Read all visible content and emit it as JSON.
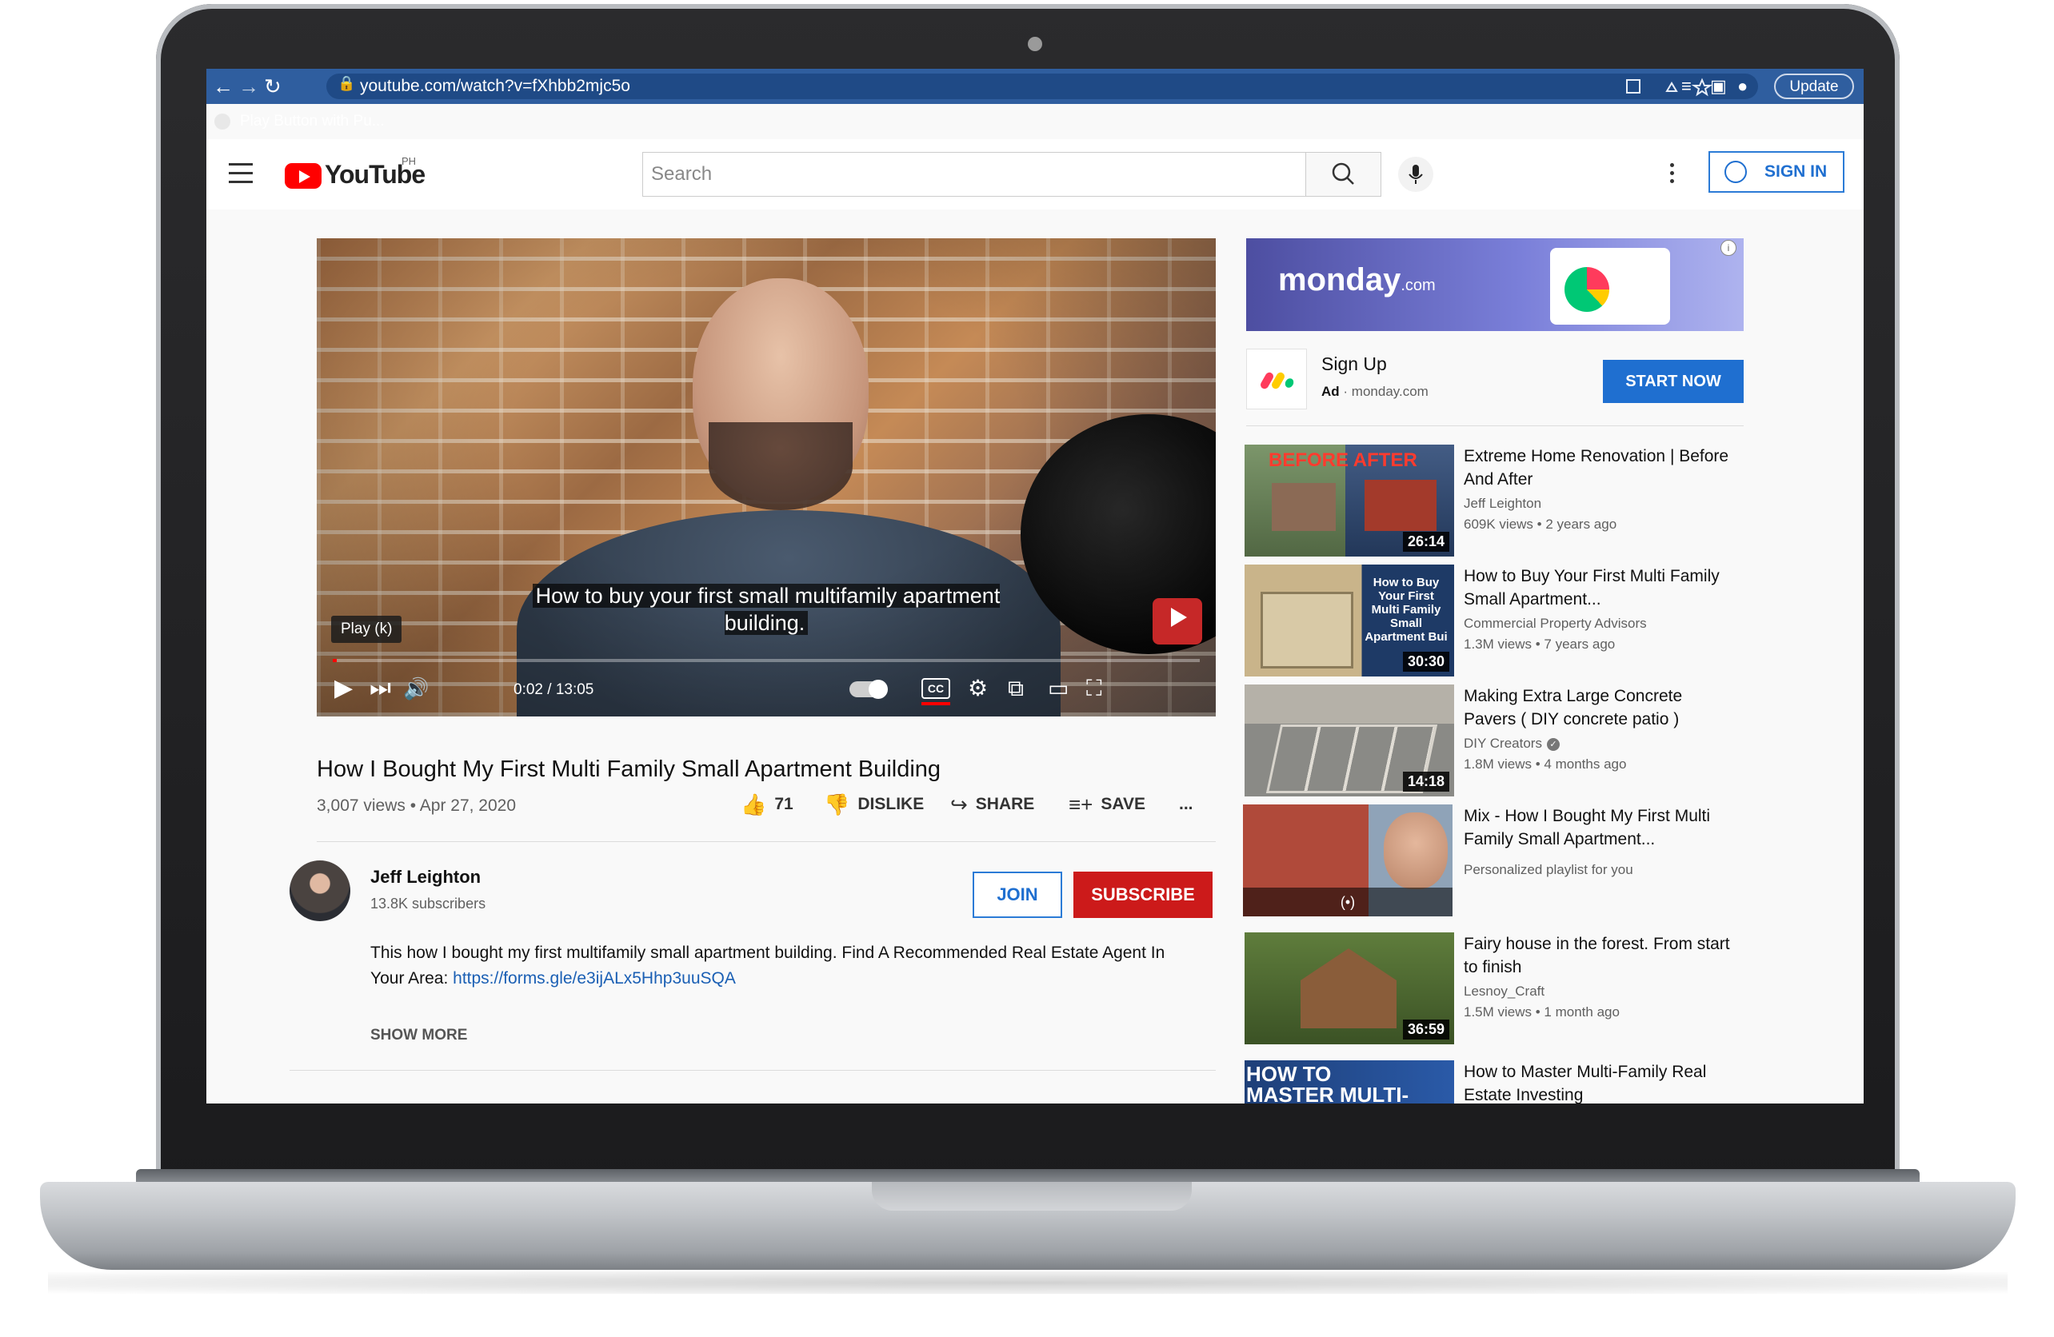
{
  "browser": {
    "url": "youtube.com/watch?v=fXhbb2mjc5o",
    "update_label": "Update",
    "bookmark": "Play Button with Pu..."
  },
  "header": {
    "logo_text": "YouTube",
    "region": "PH",
    "search_placeholder": "Search",
    "sign_in": "SIGN IN"
  },
  "player": {
    "caption": "How to buy your first small multifamily apartment building.",
    "tooltip": "Play (k)",
    "time": "0:02 / 13:05",
    "progress": 0.003,
    "cc_label": "CC"
  },
  "video": {
    "title": "How I Bought My First Multi Family Small Apartment Building",
    "views_date": "3,007 views • Apr 27, 2020",
    "likes": "71",
    "dislike": "DISLIKE",
    "share": "SHARE",
    "save": "SAVE",
    "more": "..."
  },
  "channel": {
    "name": "Jeff Leighton",
    "subscribers": "13.8K subscribers",
    "join": "JOIN",
    "subscribe": "SUBSCRIBE"
  },
  "description": {
    "text": "This how I bought my first multifamily small apartment building. Find A Recommended Real Estate Agent In Your Area:",
    "link": "https://forms.gle/e3ijALx5Hhp3uuSQA",
    "show_more": "SHOW MORE"
  },
  "ad": {
    "brand": "monday",
    "brand_suffix": ".com",
    "headline": "Sign Up",
    "ad_label": "Ad",
    "domain": "· monday.com",
    "cta": "START NOW",
    "info": "i"
  },
  "recommendations": [
    {
      "title": "Extreme Home Renovation | Before And After",
      "channel": "Jeff Leighton",
      "meta": "609K views • 2 years ago",
      "duration": "26:14",
      "thumb_text": "BEFORE  AFTER"
    },
    {
      "title": "How to Buy Your First Multi Family Small Apartment...",
      "channel": "Commercial Property Advisors",
      "meta": "1.3M views • 7 years ago",
      "duration": "30:30",
      "thumb_text": "How to Buy Your First Multi Family Small Apartment Bui"
    },
    {
      "title": "Making Extra Large Concrete Pavers ( DIY concrete patio )",
      "channel": "DIY Creators",
      "meta": "1.8M views • 4 months ago",
      "duration": "14:18",
      "thumb_text": ""
    },
    {
      "title": "Mix - How I Bought My First Multi Family Small Apartment...",
      "channel": "",
      "meta": "Personalized playlist for you",
      "duration": "",
      "thumb_text": "(•)"
    },
    {
      "title": "Fairy house in the forest. From start to finish",
      "channel": "Lesnoy_Craft",
      "meta": "1.5M views • 1 month ago",
      "duration": "36:59",
      "thumb_text": ""
    },
    {
      "title": "How to Master Multi-Family Real Estate Investing",
      "channel": "",
      "meta": "",
      "duration": "",
      "thumb_text": "HOW TO MASTER MULTI-FAMILY REAL"
    }
  ]
}
